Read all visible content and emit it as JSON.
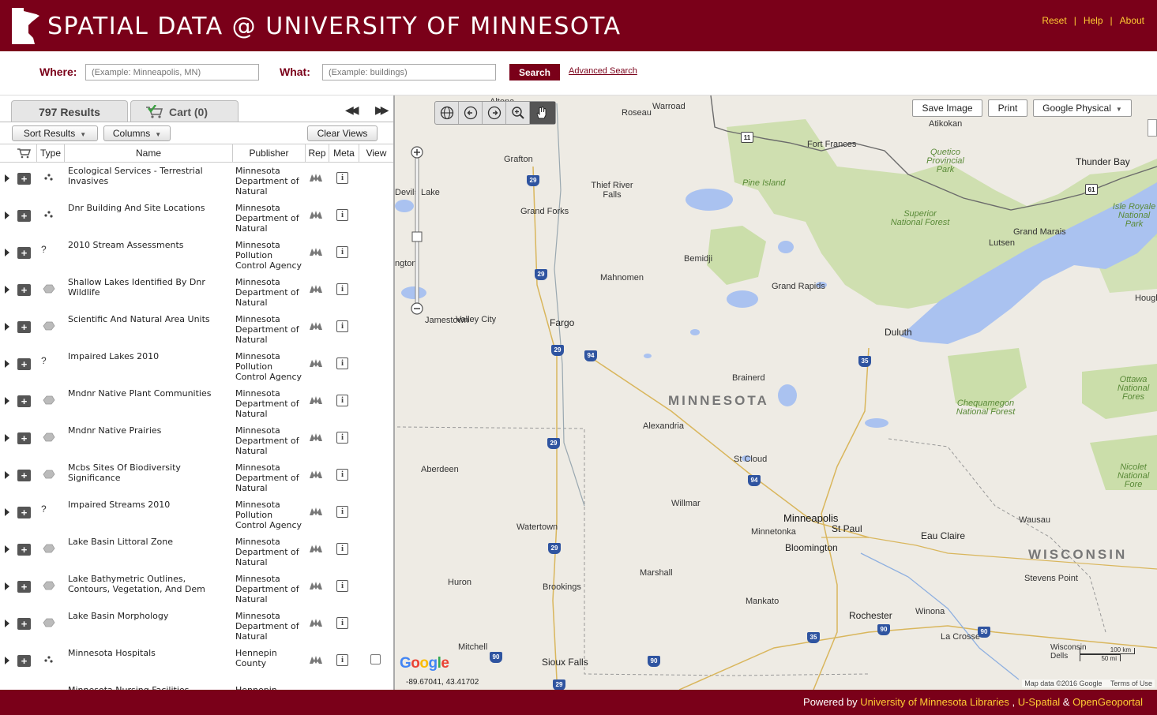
{
  "header": {
    "title": "SPATIAL DATA @ UNIVERSITY OF MINNESOTA",
    "links": [
      "Reset",
      "Help",
      "About"
    ],
    "separator": "|"
  },
  "search": {
    "where_label": "Where:",
    "where_placeholder": "(Example: Minneapolis, MN)",
    "what_label": "What:",
    "what_placeholder": "(Example: buildings)",
    "search_button": "Search",
    "advanced_link": "Advanced Search"
  },
  "panel": {
    "results_tab": "797 Results",
    "cart_tab": "Cart (0)",
    "collapse_arrow": "◀◀",
    "expand_arrow": "▶▶",
    "sort_button": "Sort Results",
    "columns_button": "Columns",
    "clear_views_button": "Clear Views",
    "columns": [
      "Type",
      "Name",
      "Publisher",
      "Rep",
      "Meta",
      "View"
    ]
  },
  "rows": [
    {
      "type": "point",
      "name": "Ecological Services - Terrestrial Invasives",
      "publisher": "Minnesota Department of Natural",
      "view": false
    },
    {
      "type": "point",
      "name": "Dnr Building And Site Locations",
      "publisher": "Minnesota Department of Natural",
      "view": false
    },
    {
      "type": "?",
      "name": "2010 Stream Assessments",
      "publisher": "Minnesota Pollution Control Agency",
      "view": false
    },
    {
      "type": "polygon",
      "name": "Shallow Lakes Identified By Dnr Wildlife",
      "publisher": "Minnesota Department of Natural",
      "view": false
    },
    {
      "type": "polygon",
      "name": "Scientific And Natural Area Units",
      "publisher": "Minnesota Department of Natural",
      "view": false
    },
    {
      "type": "?",
      "name": "Impaired Lakes 2010",
      "publisher": "Minnesota Pollution Control Agency",
      "view": false
    },
    {
      "type": "polygon",
      "name": "Mndnr Native Plant Communities",
      "publisher": "Minnesota Department of Natural",
      "view": false
    },
    {
      "type": "polygon",
      "name": "Mndnr Native Prairies",
      "publisher": "Minnesota Department of Natural",
      "view": false
    },
    {
      "type": "polygon",
      "name": "Mcbs Sites Of Biodiversity Significance",
      "publisher": "Minnesota Department of Natural",
      "view": false
    },
    {
      "type": "?",
      "name": "Impaired Streams 2010",
      "publisher": "Minnesota Pollution Control Agency",
      "view": false
    },
    {
      "type": "polygon",
      "name": "Lake Basin Littoral Zone",
      "publisher": "Minnesota Department of Natural",
      "view": false
    },
    {
      "type": "polygon",
      "name": "Lake Bathymetric Outlines, Contours, Vegetation, And Dem",
      "publisher": "Minnesota Department of Natural",
      "view": false
    },
    {
      "type": "polygon",
      "name": "Lake Basin Morphology",
      "publisher": "Minnesota Department of Natural",
      "view": false
    },
    {
      "type": "point",
      "name": "Minnesota Hospitals",
      "publisher": "Hennepin County",
      "view": true
    },
    {
      "type": "point",
      "name": "Minnesota Nursing Facilities",
      "publisher": "Hennepin",
      "view": false
    }
  ],
  "map": {
    "save_image": "Save Image",
    "print": "Print",
    "basemap": "Google Physical",
    "coords": "-89.67041, 43.41702",
    "attribution": "Map data ©2016 Google",
    "terms": "Terms of Use",
    "scale_km": "100 km",
    "scale_mi": "50 mi",
    "state_mn": "MINNESOTA",
    "state_wi": "WISCONSIN",
    "cities": {
      "warroad": "Warroad",
      "roseau": "Roseau",
      "atikokan": "Atikokan",
      "fort_frances": "Fort Frances",
      "thunder_bay": "Thunder Bay",
      "grafton": "Grafton",
      "thief_river_falls": "Thief River Falls",
      "devils_lake": "Devils Lake",
      "grand_forks": "Grand Forks",
      "bemidji": "Bemidji",
      "grand_marais": "Grand Marais",
      "lutsen": "Lutsen",
      "mahnomen": "Mahnomen",
      "grand_rapids": "Grand Rapids",
      "washington": "ngton",
      "jamestown": "Jamestown",
      "valley_city": "Valley City",
      "fargo": "Fargo",
      "duluth": "Duluth",
      "hough": "Hough",
      "brainerd": "Brainerd",
      "alexandria": "Alexandria",
      "aberdeen": "Aberdeen",
      "st_cloud": "St Cloud",
      "willmar": "Willmar",
      "minneapolis": "Minneapolis",
      "minnetonka": "Minnetonka",
      "st_paul": "St Paul",
      "bloomington": "Bloomington",
      "watertown": "Watertown",
      "wausau": "Wausau",
      "eau_claire": "Eau Claire",
      "huron": "Huron",
      "marshall": "Marshall",
      "brookings": "Brookings",
      "mankato": "Mankato",
      "rochester": "Rochester",
      "winona": "Winona",
      "stevens_point": "Stevens Point",
      "la_crosse": "La Crosse",
      "mitchell": "Mitchell",
      "sioux_falls": "Sioux Falls",
      "wisconsin_dells": "Wisconsin Dells",
      "altona": "Altona"
    },
    "parks": {
      "pine_island": "Pine Island",
      "quetico": "Quetico Provincial Park",
      "superior": "Superior National Forest",
      "isle_royale": "Isle Royale National Park",
      "ottawa": "Ottawa National Fores",
      "chequamegon": "Chequamegon National Forest",
      "nicolet": "Nicolet National Fore"
    }
  },
  "footer": {
    "prefix": "Powered by ",
    "libraries": "University of Minnesota Libraries",
    "comma": " , ",
    "uspatial": "U-Spatial",
    "amp": " & ",
    "ogp": "OpenGeoportal"
  }
}
